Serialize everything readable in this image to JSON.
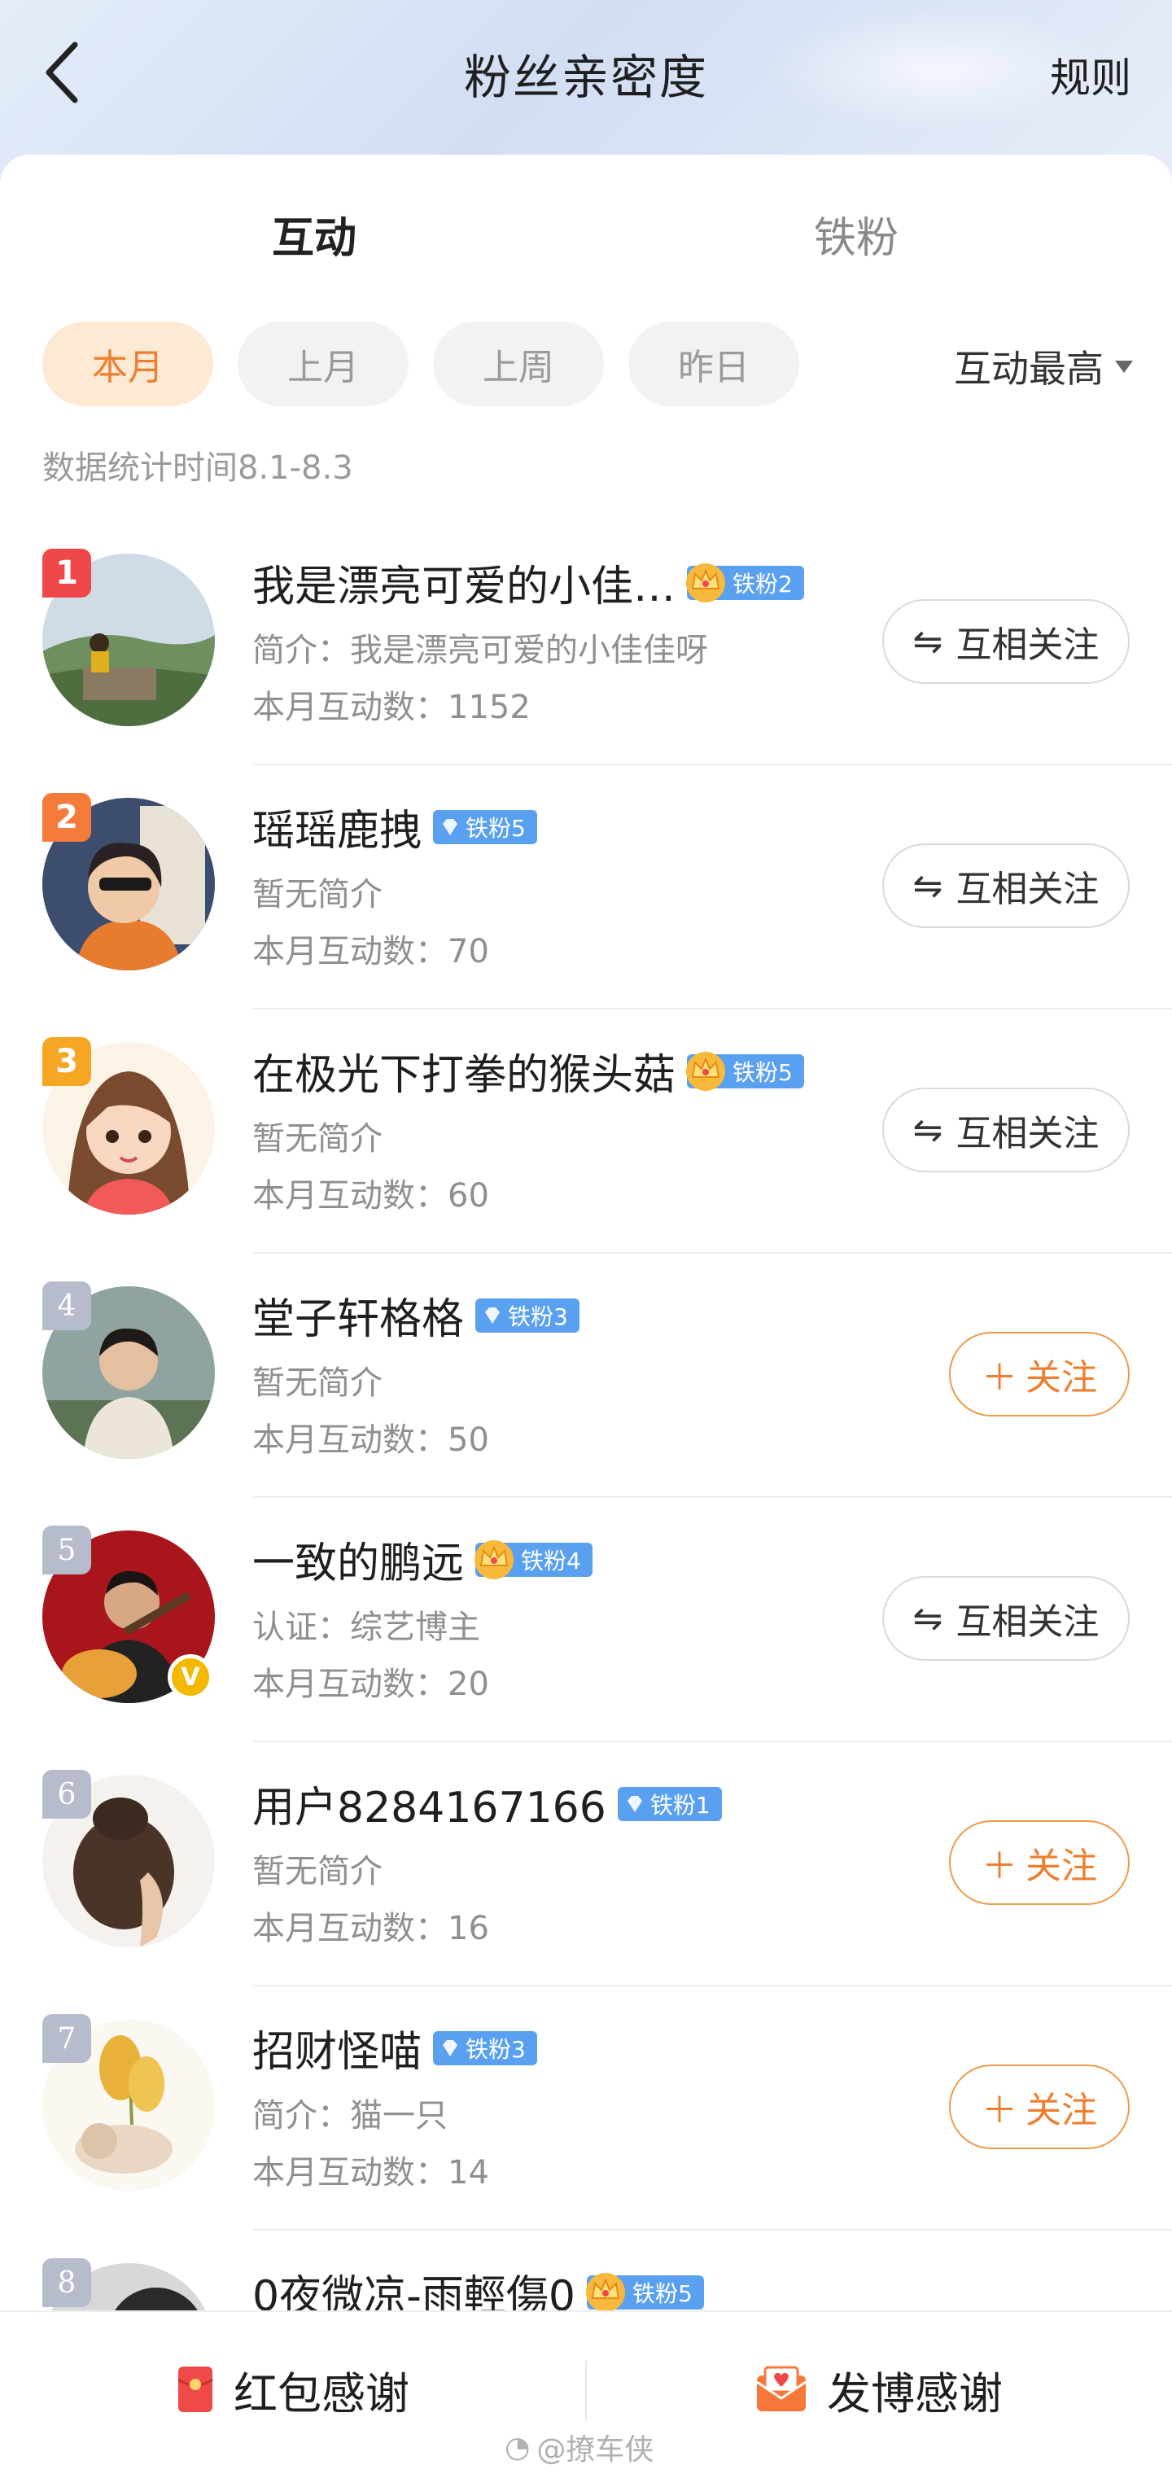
{
  "header": {
    "title": "粉丝亲密度",
    "rules": "规则"
  },
  "tabs": [
    {
      "label": "互动"
    },
    {
      "label": "铁粉"
    }
  ],
  "filters": [
    {
      "label": "本月"
    },
    {
      "label": "上月"
    },
    {
      "label": "上周"
    },
    {
      "label": "昨日"
    }
  ],
  "sort": {
    "label": "互动最高"
  },
  "stat_time": "数据统计时间8.1-8.3",
  "fans": [
    {
      "rank": "1",
      "name": "我是漂亮可爱的小佳…",
      "badge": "铁粉2",
      "intro": "简介：我是漂亮可爱的小佳佳呀",
      "count": "本月互动数：1152",
      "action": "互相关注"
    },
    {
      "rank": "2",
      "name": "瑶瑶鹿拽",
      "badge": "铁粉5",
      "intro": "暂无简介",
      "count": "本月互动数：70",
      "action": "互相关注"
    },
    {
      "rank": "3",
      "name": "在极光下打拳的猴头菇",
      "badge": "铁粉5",
      "intro": "暂无简介",
      "count": "本月互动数：60",
      "action": "互相关注"
    },
    {
      "rank": "4",
      "name": "堂子轩格格",
      "badge": "铁粉3",
      "intro": "暂无简介",
      "count": "本月互动数：50",
      "action": "关注"
    },
    {
      "rank": "5",
      "name": "一致的鹏远",
      "badge": "铁粉4",
      "intro": "认证：综艺博主",
      "count": "本月互动数：20",
      "action": "互相关注"
    },
    {
      "rank": "6",
      "name": "用户8284167166",
      "badge": "铁粉1",
      "intro": "暂无简介",
      "count": "本月互动数：16",
      "action": "关注"
    },
    {
      "rank": "7",
      "name": "招财怪喵",
      "badge": "铁粉3",
      "intro": "简介：猫一只",
      "count": "本月互动数：14",
      "action": "关注"
    },
    {
      "rank": "8",
      "name": "0夜微凉-雨輕傷0",
      "badge": "铁粉5"
    }
  ],
  "bottom": {
    "redpacket": "红包感谢",
    "post": "发博感谢"
  },
  "watermark": "@撩车侠",
  "colors": {
    "accent": "#f0635a",
    "orange": "#ee7f30",
    "badge_blue": "#5aa0f0"
  }
}
